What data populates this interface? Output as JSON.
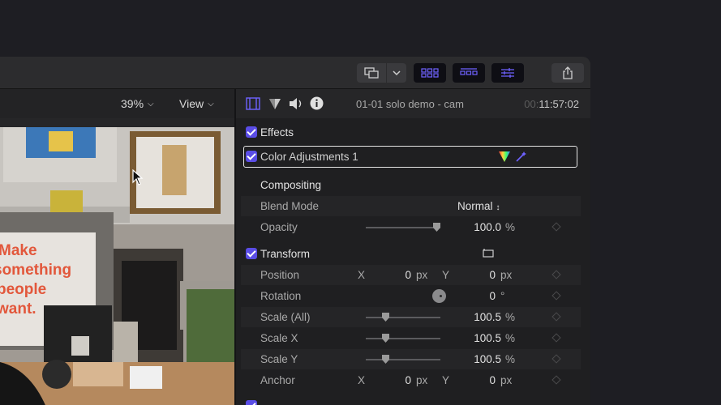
{
  "viewer": {
    "zoom_label": "39%",
    "view_label": "View",
    "poster_lines": [
      "Make",
      "something",
      "people",
      "want."
    ]
  },
  "inspector": {
    "clip_name": "01-01 solo demo - cam",
    "timecode_dim": "00:",
    "timecode": "11:57:02",
    "tab_icons": [
      "video-inspector-icon",
      "color-inspector-icon",
      "audio-inspector-icon",
      "info-inspector-icon"
    ]
  },
  "effects": {
    "header": "Effects",
    "effect_name": "Color Adjustments 1"
  },
  "compositing": {
    "header": "Compositing",
    "blend_mode_label": "Blend Mode",
    "blend_mode_value": "Normal",
    "opacity_label": "Opacity",
    "opacity_value": "100.0",
    "opacity_unit": "%",
    "opacity_level": 1.0
  },
  "transform": {
    "header": "Transform",
    "position_label": "Position",
    "position_x": "0",
    "position_y": "0",
    "rotation_label": "Rotation",
    "rotation_value": "0",
    "rotation_unit": "°",
    "scale_all_label": "Scale (All)",
    "scale_all_value": "100.5",
    "scale_x_label": "Scale X",
    "scale_x_value": "100.5",
    "scale_y_label": "Scale Y",
    "scale_y_value": "100.5",
    "anchor_label": "Anchor",
    "anchor_x": "0",
    "anchor_y": "0",
    "axis_x": "X",
    "axis_y": "Y",
    "px": "px",
    "pct": "%"
  },
  "colors": {
    "accent": "#5a4de6",
    "panel": "#1f1f21"
  }
}
